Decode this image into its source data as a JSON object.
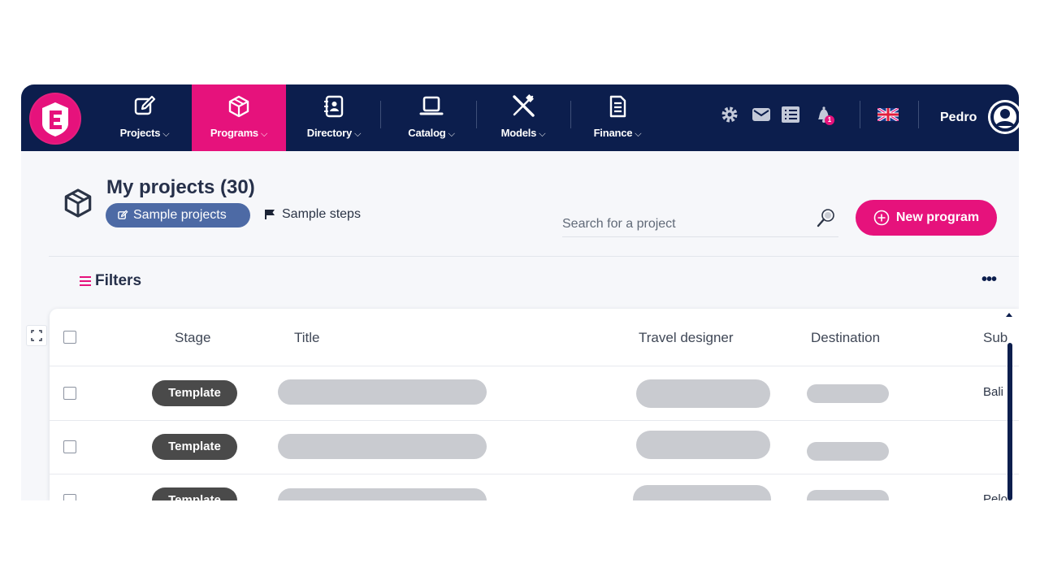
{
  "nav": {
    "logo_icon": "brand-logo-icon",
    "items": [
      {
        "label": "Projects",
        "icon": "edit-icon"
      },
      {
        "label": "Programs",
        "icon": "cube-icon",
        "active": true
      },
      {
        "label": "Directory",
        "icon": "address-book-icon"
      },
      {
        "label": "Catalog",
        "icon": "laptop-icon"
      },
      {
        "label": "Models",
        "icon": "tools-icon"
      },
      {
        "label": "Finance",
        "icon": "document-icon"
      }
    ],
    "chevron": "⌵",
    "notification_count": "1",
    "language_icon": "uk-flag-icon",
    "user_name": "Pedro"
  },
  "header": {
    "title": "My projects (30)",
    "sample_projects_label": "Sample projects",
    "sample_steps_label": "Sample steps",
    "search_placeholder": "Search for a project",
    "new_program_label": "New program"
  },
  "toolbar": {
    "filters_label": "Filters",
    "more_label": "•••"
  },
  "table": {
    "columns": [
      "Stage",
      "Title",
      "Travel designer",
      "Destination",
      "Sub"
    ],
    "rows": [
      {
        "stage": "Template",
        "sub": "Bali"
      },
      {
        "stage": "Template",
        "sub": ""
      },
      {
        "stage": "Template",
        "sub": "Pelo"
      }
    ]
  },
  "colors": {
    "navy": "#0c1e4d",
    "accent": "#e6127c",
    "chip": "#4d6aa5"
  }
}
